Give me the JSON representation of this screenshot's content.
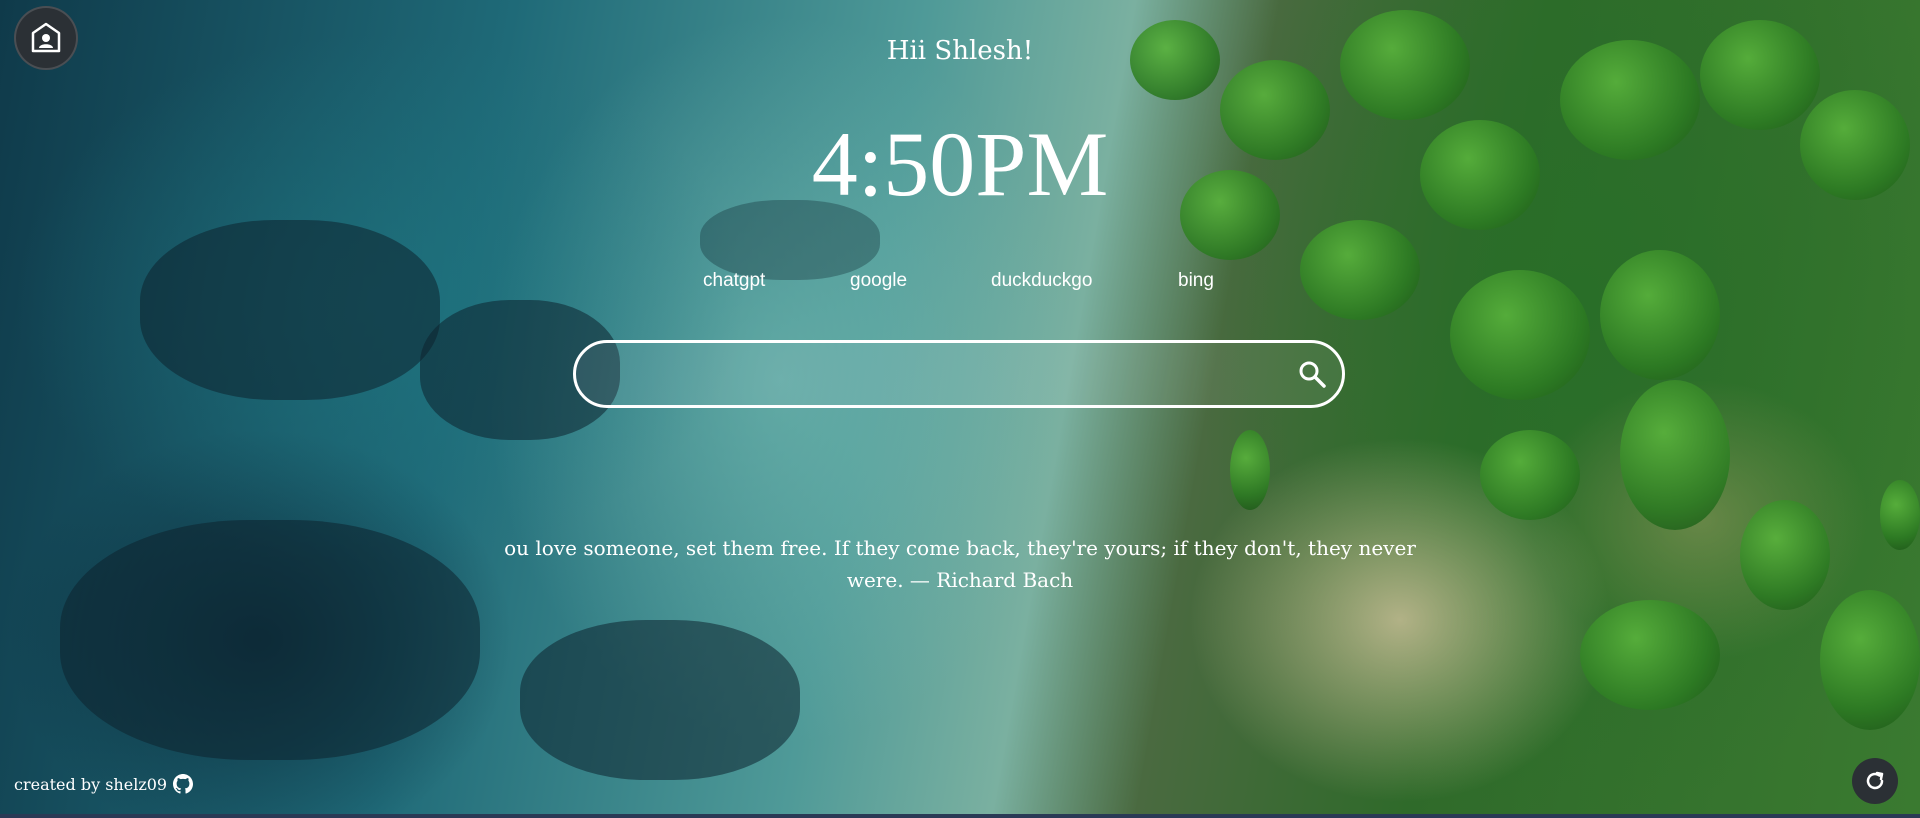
{
  "greeting": "Hii Shlesh!",
  "clock": "4:50PM",
  "engines": [
    {
      "label": "chatgpt"
    },
    {
      "label": "google"
    },
    {
      "label": "duckduckgo"
    },
    {
      "label": "bing"
    }
  ],
  "search": {
    "value": "",
    "placeholder": ""
  },
  "quote": "ou love someone, set them free. If they come back, they're yours; if they don't, they never were. — Richard Bach",
  "footer": {
    "credit": "created by shelz09"
  },
  "icons": {
    "home": "home-icon",
    "search": "search-icon",
    "github": "github-icon",
    "refresh": "refresh-icon"
  }
}
